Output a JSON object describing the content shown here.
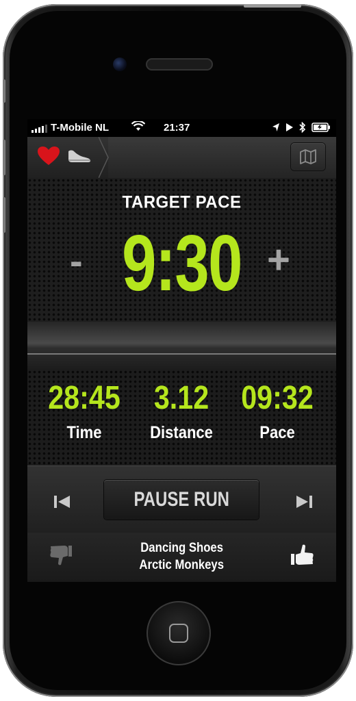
{
  "status_bar": {
    "carrier": "T-Mobile NL",
    "time": "21:37",
    "icons": [
      "signal-icon",
      "wifi-icon",
      "location-icon",
      "play-icon",
      "bluetooth-icon",
      "battery-icon"
    ]
  },
  "top_bar": {
    "icons": [
      "heart-icon",
      "shoe-icon",
      "map-icon"
    ],
    "accent_color": "#d8141b"
  },
  "target_pace": {
    "label": "TARGET PACE",
    "value": "9:30",
    "decrement_label": "-",
    "increment_label": "+"
  },
  "stats": [
    {
      "value": "28:45",
      "label": "Time"
    },
    {
      "value": "3.12",
      "label": "Distance"
    },
    {
      "value": "09:32",
      "label": "Pace"
    }
  ],
  "controls": {
    "pause_label": "PAUSE RUN",
    "icons": [
      "previous-track-icon",
      "next-track-icon"
    ]
  },
  "now_playing": {
    "title": "Dancing Shoes",
    "artist": "Arctic Monkeys",
    "icons": [
      "thumbs-down-icon",
      "thumbs-up-icon"
    ]
  },
  "colors": {
    "highlight": "#b5e61d",
    "text": "#ffffff",
    "muted": "#a3a3a3"
  }
}
